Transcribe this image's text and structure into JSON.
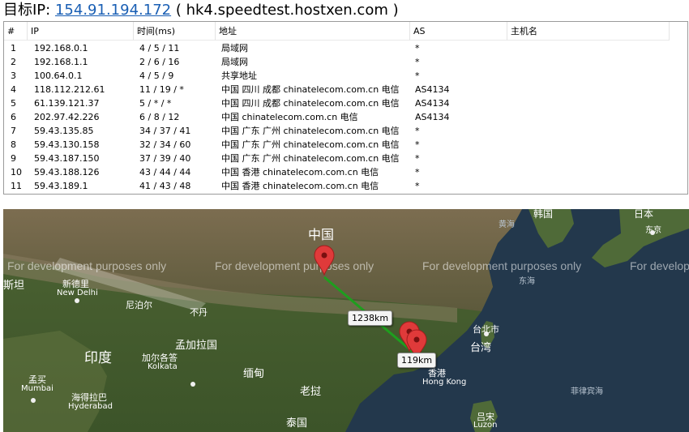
{
  "header": {
    "label": "目标IP:",
    "ip": "154.91.194.172",
    "host": " ( hk4.speedtest.hostxen.com )"
  },
  "trace_table": {
    "columns": [
      "#",
      "IP",
      "时间(ms)",
      "地址",
      "AS",
      "主机名"
    ],
    "rows": [
      {
        "n": "1",
        "ip": "192.168.0.1",
        "time": "4 / 5 / 11",
        "addr": "局域网",
        "as": "*"
      },
      {
        "n": "2",
        "ip": "192.168.1.1",
        "time": "2 / 6 / 16",
        "addr": "局域网",
        "as": "*"
      },
      {
        "n": "3",
        "ip": "100.64.0.1",
        "time": "4 / 5 / 9",
        "addr": "共享地址",
        "as": "*"
      },
      {
        "n": "4",
        "ip": "118.112.212.61",
        "time": "11 / 19 / *",
        "addr": "中国 四川 成都 chinatelecom.com.cn 电信",
        "as": "AS4134"
      },
      {
        "n": "5",
        "ip": "61.139.121.37",
        "time": "5 / * / *",
        "addr": "中国 四川 成都 chinatelecom.com.cn 电信",
        "as": "AS4134"
      },
      {
        "n": "6",
        "ip": "202.97.42.226",
        "time": "6 / 8 / 12",
        "addr": "中国 chinatelecom.com.cn 电信",
        "as": "AS4134"
      },
      {
        "n": "7",
        "ip": "59.43.135.85",
        "time": "34 / 37 / 41",
        "addr": "中国 广东 广州 chinatelecom.com.cn 电信",
        "as": "*"
      },
      {
        "n": "8",
        "ip": "59.43.130.158",
        "time": "32 / 34 / 60",
        "addr": "中国 广东 广州 chinatelecom.com.cn 电信",
        "as": "*"
      },
      {
        "n": "9",
        "ip": "59.43.187.150",
        "time": "37 / 39 / 40",
        "addr": "中国 广东 广州 chinatelecom.com.cn 电信",
        "as": "*"
      },
      {
        "n": "10",
        "ip": "59.43.188.126",
        "time": "43 / 44 / 44",
        "addr": "中国 香港 chinatelecom.com.cn 电信",
        "as": "*"
      },
      {
        "n": "11",
        "ip": "59.43.189.1",
        "time": "41 / 43 / 48",
        "addr": "中国 香港 chinatelecom.com.cn 电信",
        "as": "*"
      }
    ]
  },
  "map": {
    "watermark": "For development purposes only",
    "distances": [
      "1238km",
      "119km"
    ],
    "route_color": "#1e9e1e",
    "pin_color": "#e03a3a",
    "places": {
      "china": "中国",
      "korea": "韩国",
      "japan": "日本",
      "tokyo": "东京",
      "yellow_sea": "黄海",
      "east_sea": "东海",
      "pakistan_partial": "斯坦",
      "new_delhi_cn": "新德里",
      "new_delhi_en": "New Delhi",
      "nepal": "尼泊尔",
      "bhutan": "不丹",
      "bangladesh": "孟加拉国",
      "india": "印度",
      "kolkata_cn": "加尔各答",
      "kolkata_en": "Kolkata",
      "mumbai_cn": "孟买",
      "mumbai_en": "Mumbai",
      "hyderabad_cn": "海得拉巴",
      "hyderabad_en": "Hyderabad",
      "myanmar": "缅甸",
      "laos": "老挝",
      "thailand": "泰国",
      "hongkong_cn": "香港",
      "hongkong_en": "Hong Kong",
      "taipei": "台北市",
      "taiwan": "台湾",
      "philippine_sea": "菲律宾海",
      "luzon_cn": "吕宋",
      "luzon_en": "Luzon"
    }
  }
}
